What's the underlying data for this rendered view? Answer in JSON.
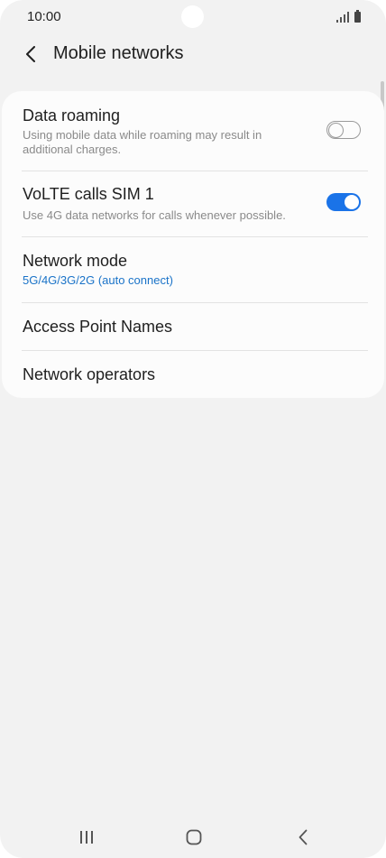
{
  "status_bar": {
    "time": "10:00",
    "icons": [
      "signal-icon",
      "battery-icon"
    ]
  },
  "header": {
    "back_icon": "chevron-left-icon",
    "title": "Mobile networks"
  },
  "settings": {
    "data_roaming": {
      "title": "Data roaming",
      "subtitle": "Using mobile data while roaming may result in additional charges.",
      "enabled": false
    },
    "volte": {
      "title": "VoLTE calls SIM 1",
      "subtitle": "Use 4G data networks for calls whenever possible.",
      "enabled": true
    },
    "network_mode": {
      "title": "Network mode",
      "value": "5G/4G/3G/2G (auto connect)"
    },
    "access_point_names": {
      "title": "Access Point Names"
    },
    "network_operators": {
      "title": "Network operators"
    }
  },
  "colors": {
    "accent": "#1a73e8",
    "background": "#f2f2f2",
    "card": "#fcfcfc"
  },
  "nav_bar": {
    "icons": [
      "recents-icon",
      "home-icon",
      "back-icon"
    ]
  }
}
